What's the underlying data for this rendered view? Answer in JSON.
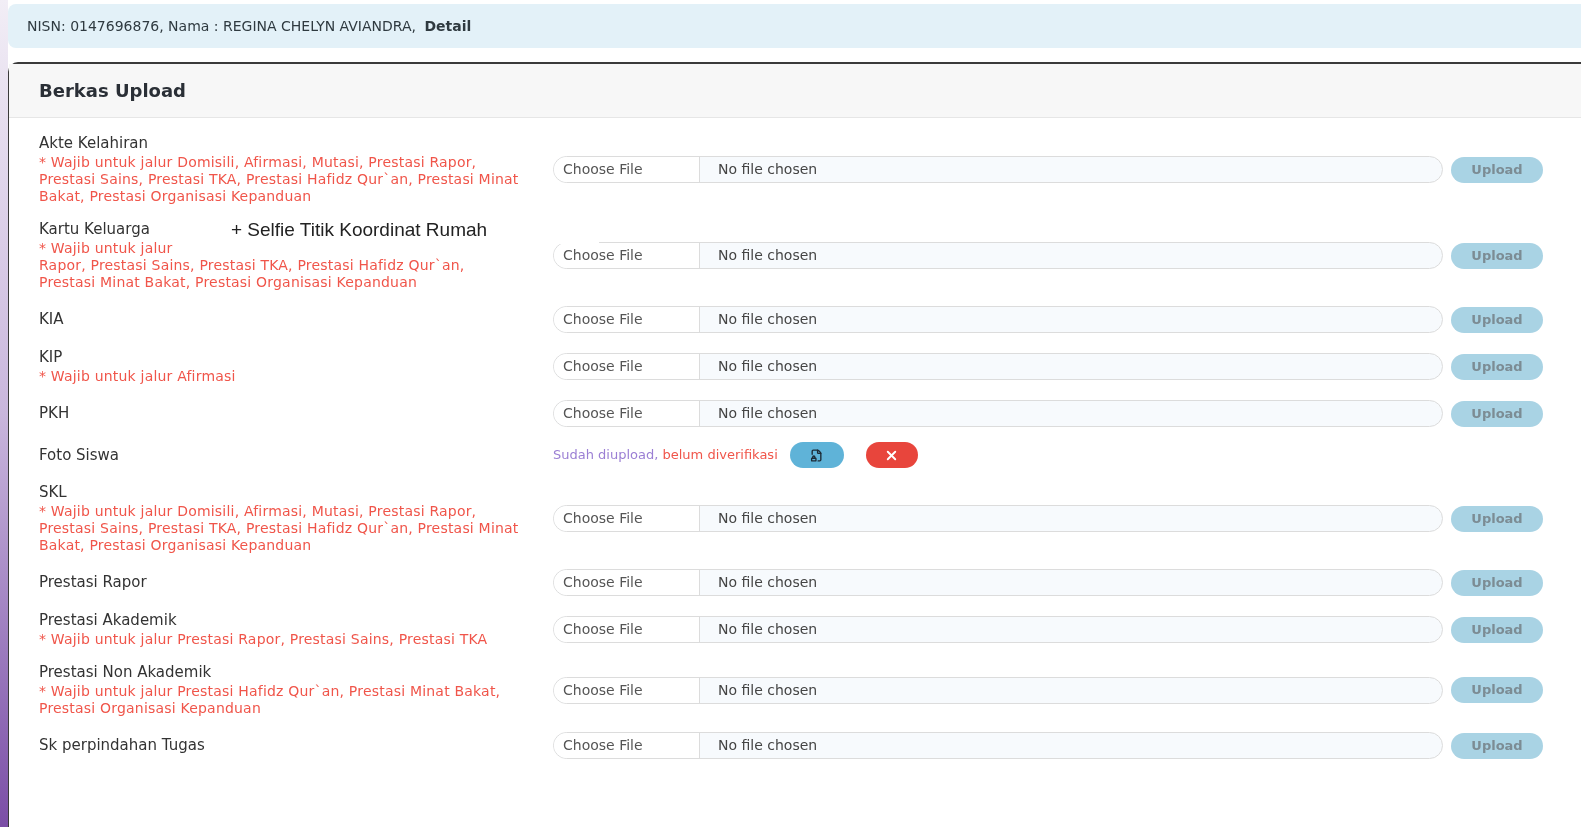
{
  "alert": {
    "text": "NISN: 0147696876, Nama : REGINA CHELYN AVIANDRA, ",
    "link": "Detail"
  },
  "card": {
    "title": "Berkas Upload"
  },
  "items": [
    {
      "kind": "file",
      "label": "Akte Kelahiran",
      "note": "* Wajib untuk jalur Domisili, Afirmasi, Mutasi, Prestasi Rapor, Prestasi Sains, Prestasi TKA, Prestasi Hafidz Qur`an, Prestasi Minat Bakat, Prestasi Organisasi Kepanduan",
      "choose": "Choose File",
      "status": "No file chosen",
      "button": "Upload"
    },
    {
      "kind": "file",
      "label": "Kartu Keluarga",
      "overlay": "+ Selfie Titik Koordinat Rumah",
      "note": "* Wajib untuk jalur",
      "note_rest": "Rapor, Prestasi Sains, Prestasi TKA, Prestasi Hafidz Qur`an, Prestasi Minat Bakat, Prestasi Organisasi Kepanduan",
      "choose": "Choose File",
      "status": "No file chosen",
      "button": "Upload"
    },
    {
      "kind": "file",
      "label": "KIA",
      "choose": "Choose File",
      "status": "No file chosen",
      "button": "Upload"
    },
    {
      "kind": "file",
      "label": "KIP",
      "note": "* Wajib untuk jalur Afirmasi",
      "choose": "Choose File",
      "status": "No file chosen",
      "button": "Upload"
    },
    {
      "kind": "file",
      "label": "PKH",
      "choose": "Choose File",
      "status": "No file chosen",
      "button": "Upload"
    },
    {
      "kind": "uploaded",
      "label": "Foto Siswa",
      "uploaded_text": "Sudah diupload,",
      "verify_text": "belum diverifikasi"
    },
    {
      "kind": "file",
      "label": "SKL",
      "note": "* Wajib untuk jalur Domisili, Afirmasi, Mutasi, Prestasi Rapor, Prestasi Sains, Prestasi TKA, Prestasi Hafidz Qur`an, Prestasi Minat Bakat, Prestasi Organisasi Kepanduan",
      "choose": "Choose File",
      "status": "No file chosen",
      "button": "Upload"
    },
    {
      "kind": "file",
      "label": "Prestasi Rapor",
      "choose": "Choose File",
      "status": "No file chosen",
      "button": "Upload"
    },
    {
      "kind": "file",
      "label": "Prestasi Akademik",
      "note": "* Wajib untuk jalur Prestasi Rapor, Prestasi Sains, Prestasi TKA",
      "choose": "Choose File",
      "status": "No file chosen",
      "button": "Upload"
    },
    {
      "kind": "file",
      "label": "Prestasi Non Akademik",
      "note": "* Wajib untuk jalur Prestasi Hafidz Qur`an, Prestasi Minat Bakat, Prestasi Organisasi Kepanduan",
      "choose": "Choose File",
      "status": "No file chosen",
      "button": "Upload"
    },
    {
      "kind": "file",
      "label": "Sk perpindahan Tugas",
      "choose": "Choose File",
      "status": "No file chosen",
      "button": "Upload"
    }
  ]
}
